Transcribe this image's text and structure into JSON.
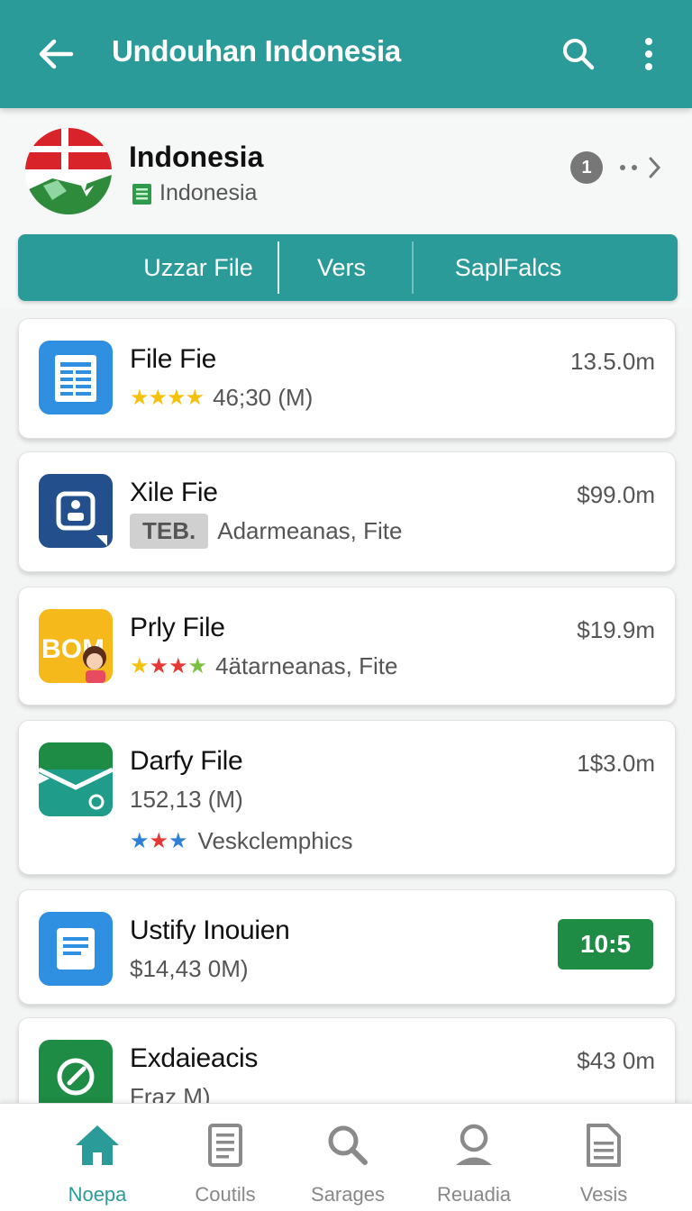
{
  "appbar": {
    "title": "Undouhan Indonesia",
    "back_icon": "arrow-left-icon",
    "search_icon": "search-icon",
    "more_icon": "more-vertical-icon"
  },
  "header": {
    "name": "Indonesia",
    "subtitle": "Indonesia",
    "badge_count": "1",
    "more_text": "··›"
  },
  "tabs": [
    "Uzzar File",
    "Vers",
    "SaplFalcs"
  ],
  "items": [
    {
      "name": "File Fie",
      "price": "13.5.0m",
      "stars": "★★★★",
      "stars_color": "#f4c20d",
      "meta": "46;30 (M)"
    },
    {
      "name": "Xile Fie",
      "price": "$99.0m",
      "tag": "TEB.",
      "meta": "Adarmeanas, Fite"
    },
    {
      "name": "Prly File",
      "price": "$19.9m",
      "stars": "★★★★",
      "meta": "4ätarneanas, Fite",
      "icon_text": "BOM"
    },
    {
      "name": "Darfy File",
      "price": "1$3.0m",
      "meta": "152,13 (M)",
      "stars": "★★★",
      "meta2": "Veskclemphics"
    },
    {
      "name": "Ustify Inouien",
      "meta": "$14,43 0M)",
      "button": "10:5"
    },
    {
      "name": "Exdaieacis",
      "price": "$43 0m",
      "meta": "Fraz M)"
    }
  ],
  "bottom_nav": [
    {
      "label": "Noepa",
      "icon": "home-icon",
      "active": true
    },
    {
      "label": "Coutils",
      "icon": "document-icon",
      "active": false
    },
    {
      "label": "Sarages",
      "icon": "search-icon",
      "active": false
    },
    {
      "label": "Reuadia",
      "icon": "user-icon",
      "active": false
    },
    {
      "label": "Vesis",
      "icon": "file-icon",
      "active": false
    }
  ],
  "colors": {
    "primary": "#2a9b98",
    "accent_green": "#1e8c45",
    "star_yellow": "#f4c20d",
    "star_red": "#e53935",
    "star_blue": "#2e7fd6"
  }
}
